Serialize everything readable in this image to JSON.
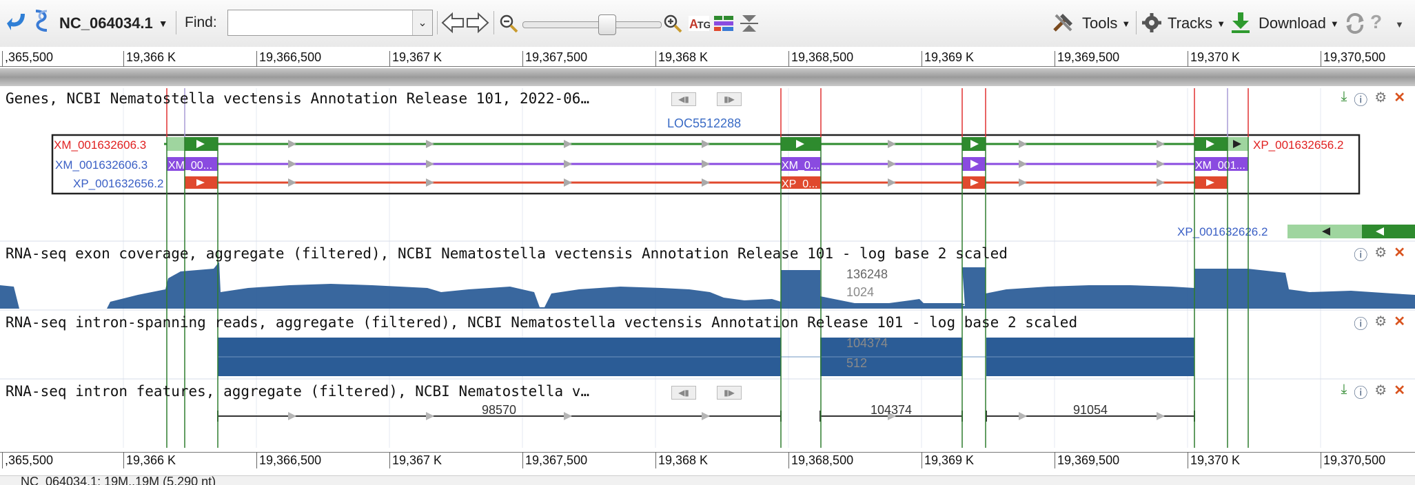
{
  "toolbar": {
    "sequence": "NC_064034.1",
    "find_label": "Find:",
    "tools_label": "Tools",
    "tracks_label": "Tracks",
    "download_label": "Download"
  },
  "ruler": {
    "labels": [
      ",365,500",
      "19,366 K",
      "19,366,500",
      "19,367 K",
      "19,367,500",
      "19,368 K",
      "19,368,500",
      "19,369 K",
      "19,369,500",
      "19,370 K",
      "19,370,500"
    ]
  },
  "tracks": {
    "genes": {
      "title": "Genes, NCBI Nematostella vectensis Annotation Release 101, 2022-06…",
      "locus": "LOC5512288",
      "row1_label": "XM_001632606.3",
      "row2_label": "XM_001632606.3",
      "row3_label": "XP_001632656.2",
      "row1_right_label": "XP_001632656.2",
      "row2_exon_label": "XM_00...",
      "row2_exon_label_b": "XM_0...",
      "row2_exon_label_c": "XM_001...",
      "row3_exon_label": "XP_0...",
      "other_label": "XP_001632626.2"
    },
    "exon_coverage": {
      "title": "RNA-seq exon coverage, aggregate (filtered), NCBI Nematostella vectensis Annotation Release 101 - log base 2 scaled",
      "max_label": "136248",
      "mid_label": "1024"
    },
    "intron_reads": {
      "title": "RNA-seq intron-spanning reads, aggregate (filtered), NCBI Nematostella vectensis Annotation Release 101 - log base 2 scaled",
      "max_label": "104374",
      "mid_label": "512"
    },
    "intron_features": {
      "title": "RNA-seq intron features, aggregate (filtered), NCBI Nematostella v…",
      "counts": [
        "98570",
        "104374",
        "91054"
      ]
    }
  },
  "status": {
    "text": "NC_064034.1: 19M..19M (5,290 nt)"
  },
  "colors": {
    "green": "#2e8b2e",
    "purple": "#8a4be0",
    "red": "#e0492e",
    "coverage": "#2e5f99"
  }
}
